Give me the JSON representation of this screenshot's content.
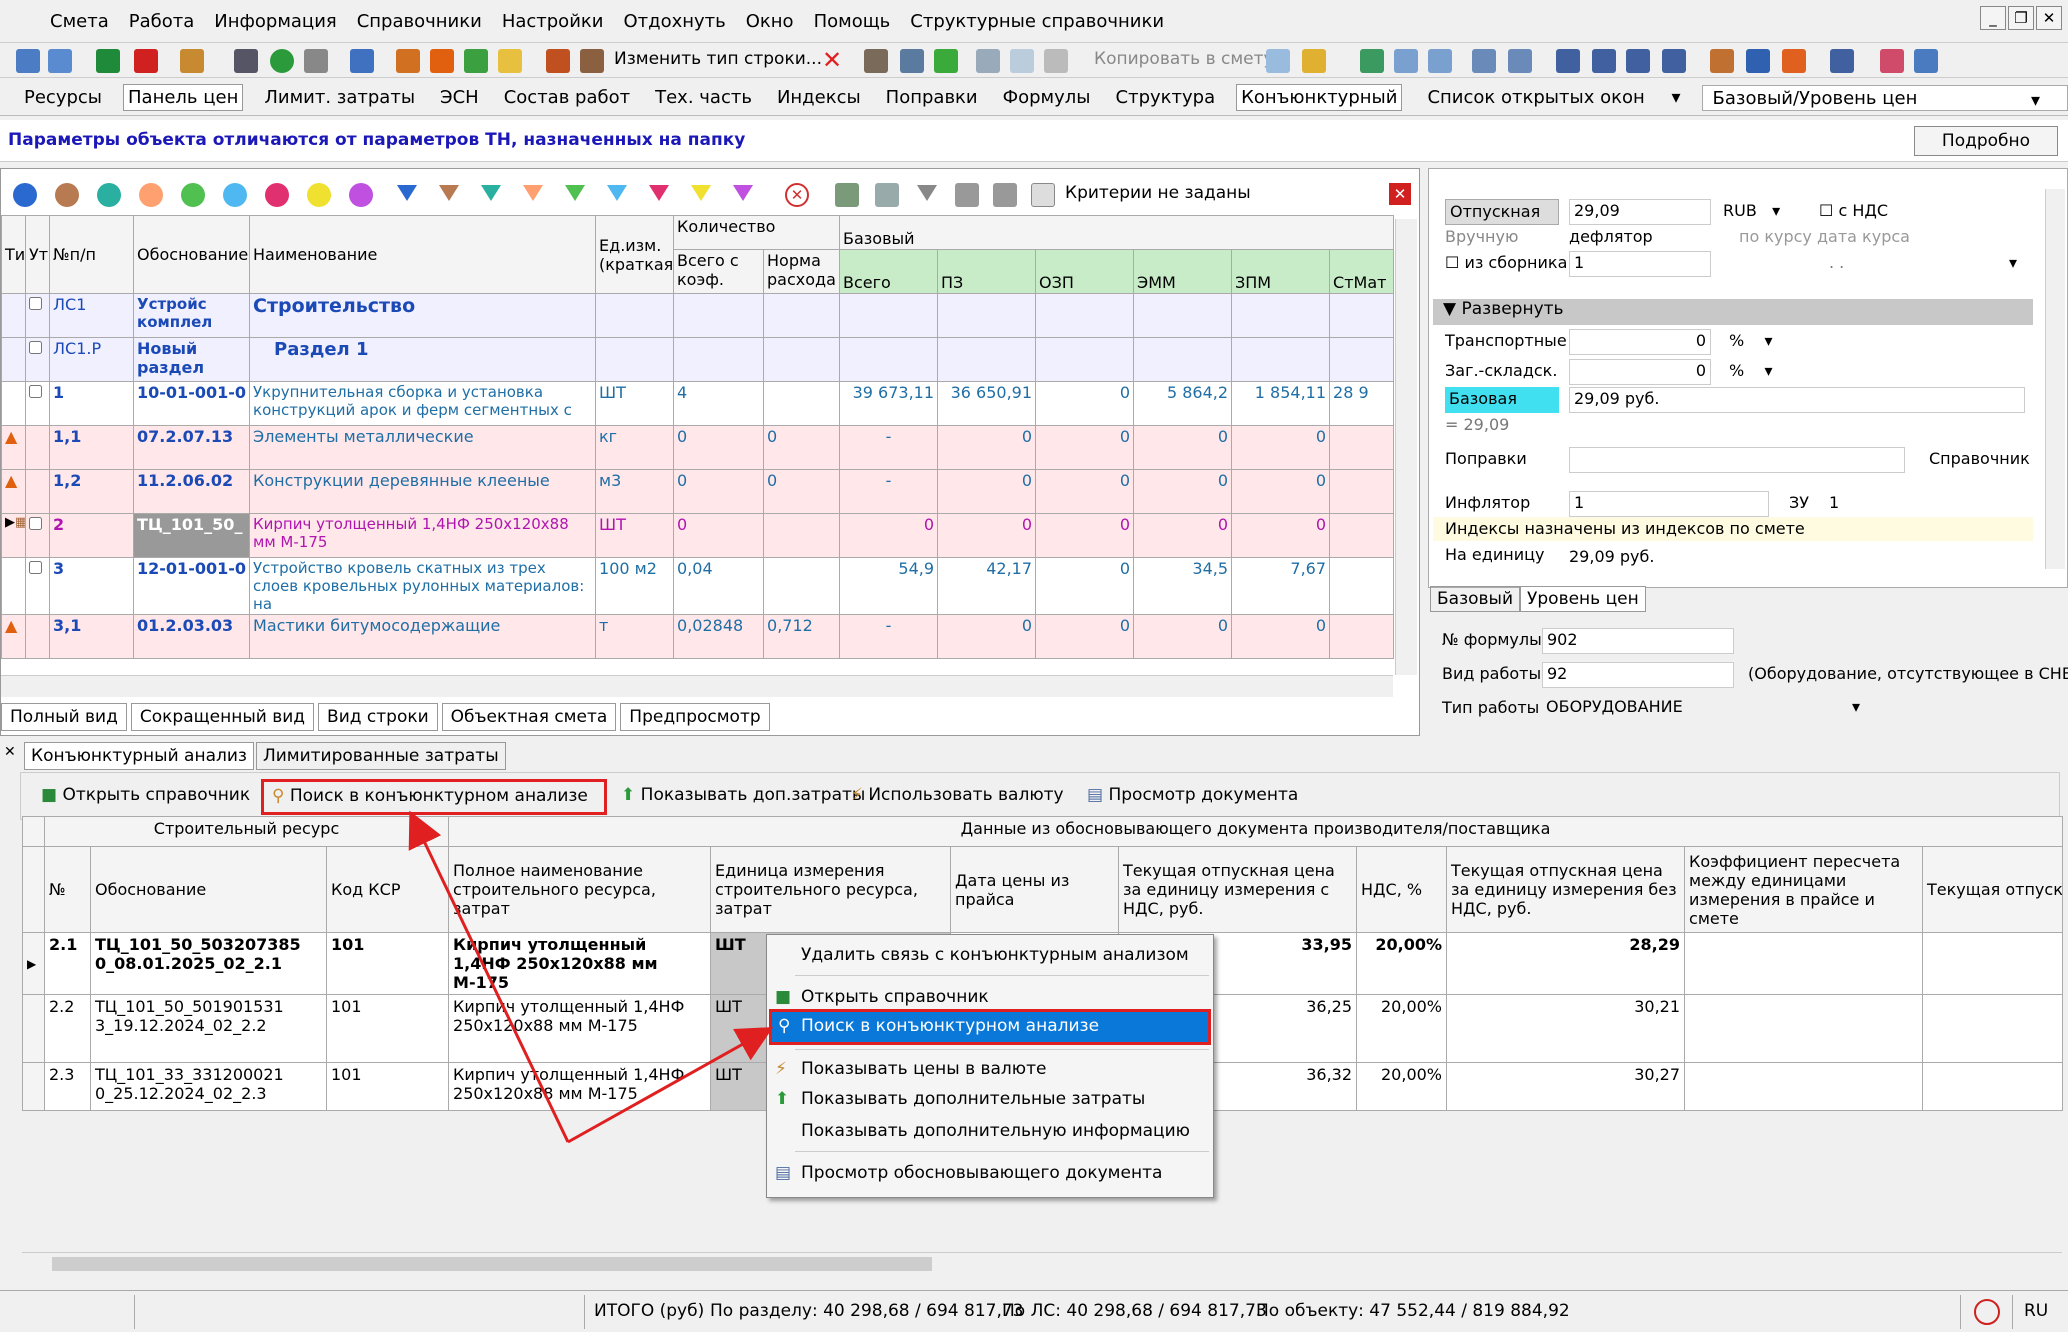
{
  "menu": [
    "Смета",
    "Работа",
    "Информация",
    "Справочники",
    "Настройки",
    "Отдохнуть",
    "Окно",
    "Помощь",
    "Структурные справочники"
  ],
  "toolbar": {
    "change_row_type": "Изменить тип строки...",
    "copy_to_estimate": "Копировать в смету"
  },
  "tabs": [
    "Ресурсы",
    "Панель цен",
    "Лимит. затраты",
    "ЭСН",
    "Состав работ",
    "Тех. часть",
    "Индексы",
    "Поправки",
    "Формулы",
    "Структура",
    "Конъюнктурный",
    "Список открытых окон"
  ],
  "active_tab": "Конъюнктурный",
  "price_level_combo": "Базовый/Уровень цен",
  "info_message": "Параметры объекта отличаются от параметров ТН, назначенных на папку",
  "details_button": "Подробно",
  "filter_status": "Критерии не заданы",
  "grid": {
    "headers": {
      "ti": "Ти",
      "ut": "Ут",
      "npp": "№п/п",
      "basis": "Обоснование",
      "name": "Наименование",
      "unit": "Ед.изм. (краткая)",
      "qty": "Количество",
      "qty_total": "Всего с коэф.",
      "norm": "Норма расхода",
      "base": "Базовый",
      "total": "Всего",
      "pz": "ПЗ",
      "ozp": "ОЗП",
      "emm": "ЭММ",
      "zpm": "ЗПМ",
      "stmat": "СтМат"
    },
    "rows": [
      {
        "npp": "ЛС1",
        "basis": "Устройс комплел",
        "name": "Строительство",
        "unit": "",
        "qty": "",
        "norm": "",
        "total": "",
        "pz": "",
        "ozp": "",
        "emm": "",
        "zpm": "",
        "st": ""
      },
      {
        "npp": "ЛС1.Р",
        "basis": "Новый раздел",
        "name": "Раздел 1",
        "unit": "",
        "qty": "",
        "norm": "",
        "total": "",
        "pz": "",
        "ozp": "",
        "emm": "",
        "zpm": "",
        "st": ""
      },
      {
        "npp": "1",
        "basis": "10-01-001-0",
        "name": "Укрупнительная сборка и установка конструкций арок и ферм сегментных с",
        "unit": "ШТ",
        "qty": "4",
        "norm": "",
        "total": "39 673,11",
        "pz": "36 650,91",
        "ozp": "0",
        "emm": "5 864,2",
        "zpm": "1 854,11",
        "st": "28 9"
      },
      {
        "npp": "1,1",
        "basis": "07.2.07.13",
        "name": "Элементы металлические",
        "unit": "кг",
        "qty": "0",
        "norm": "0",
        "total": "-",
        "pz": "0",
        "ozp": "0",
        "emm": "0",
        "zpm": "0",
        "st": ""
      },
      {
        "npp": "1,2",
        "basis": "11.2.06.02",
        "name": "Конструкции деревянные клееные",
        "unit": "м3",
        "qty": "0",
        "norm": "0",
        "total": "-",
        "pz": "0",
        "ozp": "0",
        "emm": "0",
        "zpm": "0",
        "st": ""
      },
      {
        "npp": "2",
        "basis": "ТЦ_101_50_",
        "name": "Кирпич утолщенный 1,4НФ 250х120х88 мм М-175",
        "unit": "ШТ",
        "qty": "0",
        "norm": "",
        "total": "0",
        "pz": "0",
        "ozp": "0",
        "emm": "0",
        "zpm": "0",
        "st": ""
      },
      {
        "npp": "3",
        "basis": "12-01-001-0",
        "name": "Устройство кровель скатных из трех слоев кровельных рулонных материалов: на",
        "unit": "100 м2",
        "qty": "0,04",
        "norm": "",
        "total": "54,9",
        "pz": "42,17",
        "ozp": "0",
        "emm": "34,5",
        "zpm": "7,67",
        "st": ""
      },
      {
        "npp": "3,1",
        "basis": "01.2.03.03",
        "name": "Мастики битумосодержащие",
        "unit": "т",
        "qty": "0,02848",
        "norm": "0,712",
        "total": "-",
        "pz": "0",
        "ozp": "0",
        "emm": "0",
        "zpm": "0",
        "st": ""
      }
    ]
  },
  "view_tabs": [
    "Полный вид",
    "Сокращенный вид",
    "Вид строки",
    "Объектная смета",
    "Предпросмотр"
  ],
  "right_panel": {
    "otpusk_label": "Отпускная",
    "otpusk_value": "29,09",
    "currency": "RUB",
    "vat_label": "с НДС",
    "manual": "Вручную",
    "deflator": "дефлятор",
    "by_rate": "по курсу дата курса",
    "from_collection": "из сборника",
    "collection_value": "1",
    "dots": ". .",
    "expand": "Развернуть",
    "transport": "Транспортные",
    "transport_value": "0",
    "pct": "%",
    "storage": "Заг.-складск.",
    "storage_value": "0",
    "base_label": "Базовая",
    "base_value": "29,09 руб.",
    "eq": "= 29,09",
    "corrections": "Поправки",
    "reference": "Справочник",
    "inflator": "Инфлятор",
    "inflator_value": "1",
    "zu": "ЗУ",
    "zu_value": "1",
    "indexes_note": "Индексы назначены из индексов по смете",
    "per_unit": "На единицу",
    "per_unit_value": "29,09 руб.",
    "tabs": [
      "Базовый",
      "Уровень цен"
    ]
  },
  "formula": {
    "num_label": "№ формулы",
    "num": "902",
    "work_label": "Вид работы",
    "work": "92",
    "work_note": "(Оборудование, отсутствующее в СНБ)",
    "type_label": "Тип работы",
    "type": "ОБОРУДОВАНИЕ"
  },
  "bottom_tabs": [
    "Конъюнктурный анализ",
    "Лимитированные затраты"
  ],
  "bottom_toolbar": [
    "Открыть справочник",
    "Поиск в конъюнктурном анализе",
    "Показывать доп.затраты",
    "Использовать валюту",
    "Просмотр документа"
  ],
  "analysis": {
    "group1": "Строительный ресурс",
    "group2": "Данные из обосновывающего документа производителя/поставщика",
    "headers": [
      "№",
      "Обоснование",
      "Код КСР",
      "Полное наименование строительного ресурса, затрат",
      "Единица измерения строительного ресурса, затрат",
      "Дата цены из прайса",
      "Текущая отпускная цена за единицу измерения с НДС, руб.",
      "НДС, %",
      "Текущая отпускная цена за единицу измерения без НДС, руб.",
      "Коэффициент пересчета между единицами измерения в прайсе и смете",
      "Текущая отпуск измерения в см"
    ],
    "rows": [
      {
        "n": "2.1",
        "basis": "ТЦ_101_50_503207385 0_08.01.2025_02_2.1",
        "ksr": "101",
        "name": "Кирпич утолщенный 1,4НФ 250х120х88 мм М-175",
        "unit": "ШТ",
        "price_vat": "33,95",
        "vat": "20,00%",
        "price": "28,29"
      },
      {
        "n": "2.2",
        "basis": "ТЦ_101_50_501901531 3_19.12.2024_02_2.2",
        "ksr": "101",
        "name": "Кирпич утолщенный 1,4НФ 250х120х88 мм М-175",
        "unit": "ШТ",
        "price_vat": "36,25",
        "vat": "20,00%",
        "price": "30,21"
      },
      {
        "n": "2.3",
        "basis": "ТЦ_101_33_331200021 0_25.12.2024_02_2.3",
        "ksr": "101",
        "name": "Кирпич утолщенный 1,4НФ 250х120х88 мм М-175",
        "unit": "ШТ",
        "price_vat": "36,32",
        "vat": "20,00%",
        "price": "30,27"
      }
    ]
  },
  "context_menu": [
    "Удалить связь с конъюнктурным анализом",
    "Открыть справочник",
    "Поиск в конъюнктурном анализе",
    "Показывать цены в валюте",
    "Показывать дополнительные затраты",
    "Показывать дополнительную информацию",
    "Просмотр обосновывающего документа"
  ],
  "status": {
    "total": "ИТОГО (руб)",
    "section": "По разделу: 40 298,68 / 694 817,73",
    "ls": "По ЛС: 40 298,68 / 694 817,73",
    "object": "По объекту: 47 552,44 / 819 884,92",
    "lang": "RU"
  }
}
